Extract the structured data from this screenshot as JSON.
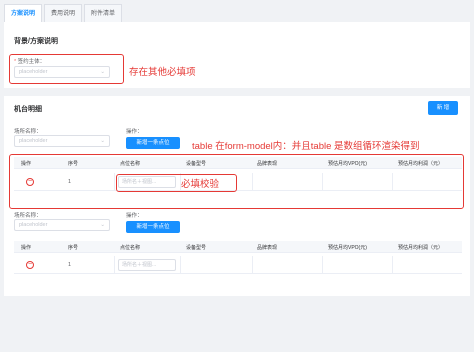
{
  "tabs": [
    "方案说明",
    "费用说明",
    "附件清单"
  ],
  "section1": {
    "title": "背景/方案说明",
    "field_label": "签约主体：",
    "required_mark": "*",
    "placeholder": "placeholder",
    "annotation": "存在其他必填项"
  },
  "section2": {
    "title": "机台明细",
    "add_button": "新 增",
    "annotation_table": "table 在form-model内：并且table 是数组循环渲染得到",
    "annotation_validate": "必填校验",
    "groups": [
      {
        "place_label": "场所名称：",
        "place_placeholder": "placeholder",
        "op_label": "操作：",
        "add_row_button": "新增一条点位",
        "columns": [
          "操作",
          "序号",
          "点位名称",
          "设备型号",
          "品牌表现",
          "预估月均VPO(元)",
          "预估月均利润（元）"
        ],
        "row": {
          "index": "1",
          "input_placeholder": "场所名＋视图..."
        }
      },
      {
        "place_label": "场所名称：",
        "place_placeholder": "placeholder",
        "op_label": "操作：",
        "add_row_button": "新增一条点位",
        "columns": [
          "操作",
          "序号",
          "点位名称",
          "设备型号",
          "品牌表现",
          "预估月均VPO(元)",
          "预估月均利润（元）"
        ],
        "row": {
          "index": "1",
          "input_placeholder": "场所名＋视图..."
        }
      }
    ]
  },
  "colors": {
    "primary": "#1890ff",
    "annotation": "#e53935",
    "danger": "#e53935"
  }
}
